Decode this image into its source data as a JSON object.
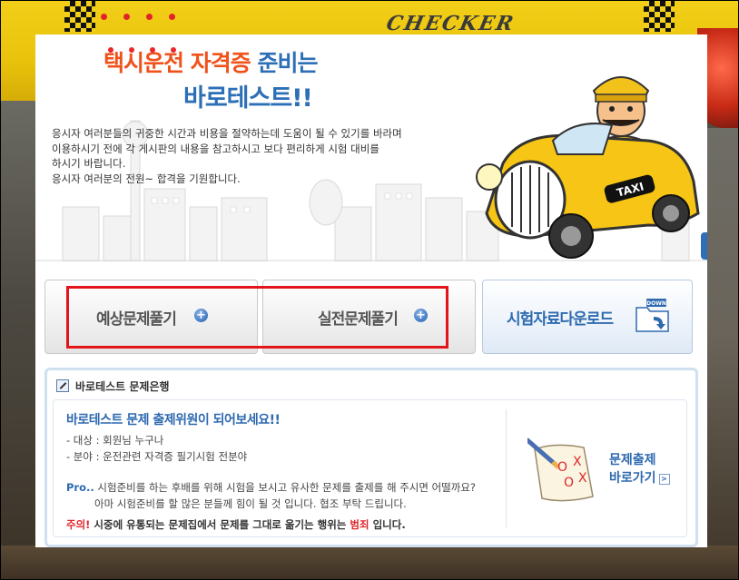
{
  "hero": {
    "title_part1": "택시운전 자격증",
    "title_part2": "준비는",
    "title_line2": "바로테스트!!",
    "intro_lines": [
      "응시자 여러분들의 귀중한 시간과 비용을 절약하는데 도움이 될 수 있기를 바라며",
      "이용하시기  전에 각 게시판의 내용을 참고하시고 보다 편리하게 시험 대비를",
      "하시기 바랍니다.",
      "응시자 여러분의 전원~ 합격을 기원합니다."
    ],
    "taxi_sign": "TAXI"
  },
  "buttons": {
    "predicted": "예상문제풀기",
    "actual": "실전문제풀기",
    "download": "시험자료다운로드",
    "download_badge": "DOWN"
  },
  "bank": {
    "header": "바로테스트 문제은행",
    "title": "바로테스트 문제 출제위원이 되어보세요!!",
    "target": "- 대상 : 회원님 누구나",
    "field": "- 분야 : 운전관련 자격증 필기시험 전분야",
    "pro_label": "Pro..",
    "pro_line1": "시험준비를 하는 후배를 위해 시험을 보시고 유사한 문제를 출제를 해 주시면 어떨까요?",
    "pro_line2": "아마 시험준비를 할 많은 분들께 힘이 될 것 입니다. 협조 부탁 드립니다.",
    "warn_label": "주의!",
    "warn_text": "시중에 유통되는 문제집에서 문제를 그대로 옮기는 행위는",
    "warn_crime": "범죄",
    "warn_end": "입니다.",
    "goto_line1": "문제출제",
    "goto_line2": "바로가기"
  },
  "background": {
    "brand_text": "CHECKER"
  },
  "colors": {
    "orange": "#f0521b",
    "blue": "#2d6fb6",
    "highlight_red": "#e4141b",
    "taxi_yellow": "#f2cf18"
  }
}
